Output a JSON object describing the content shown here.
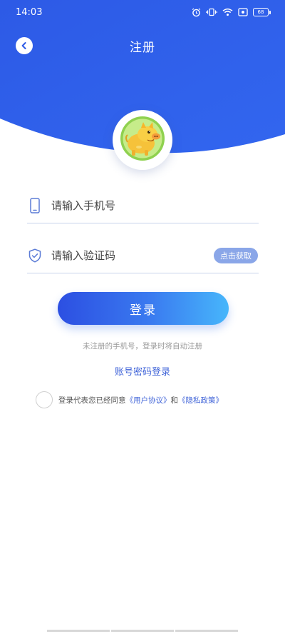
{
  "status_bar": {
    "time": "14:03",
    "icons": [
      "alarm-icon",
      "vibrate-icon",
      "wifi-icon",
      "screen-record-icon",
      "battery-icon"
    ],
    "battery_level": "68"
  },
  "nav": {
    "title": "注册",
    "back_icon": "chevron-left-icon"
  },
  "avatar": {
    "icon": "cartoon-pig-logo"
  },
  "form": {
    "phone": {
      "placeholder": "请输入手机号",
      "value": "",
      "icon": "phone-icon"
    },
    "code": {
      "placeholder": "请输入验证码",
      "value": "",
      "icon": "shield-check-icon",
      "get_code_label": "点击获取"
    },
    "login_label": "登录",
    "hint": "未注册的手机号，登录时将自动注册",
    "account_login_label": "账号密码登录"
  },
  "agreement": {
    "prefix": "登录代表您已经同意",
    "user_agreement": "《用户协议》",
    "conjunction": "和",
    "privacy_policy": "《隐私政策》",
    "checked": false
  },
  "colors": {
    "primary": "#2f5ce6",
    "link": "#3f63d8",
    "code_button": "#8aa6e8",
    "divider": "#c8d3ec"
  }
}
